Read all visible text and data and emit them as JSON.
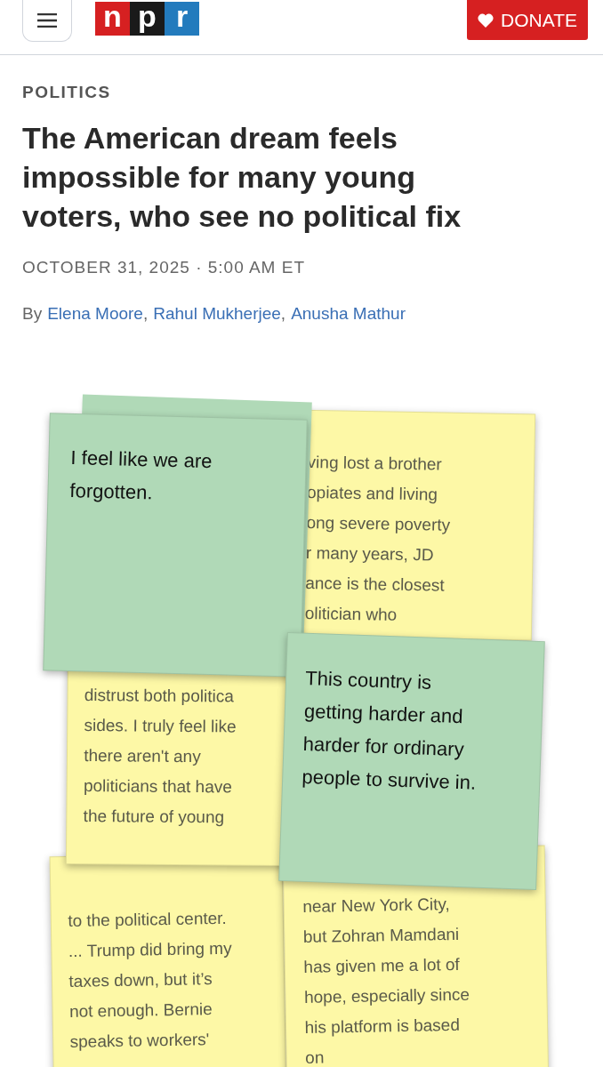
{
  "header": {
    "logo": [
      "n",
      "p",
      "r"
    ],
    "donate": "DONATE"
  },
  "section": "POLITICS",
  "headline": "The American dream feels impossible for many young voters, who see no political fix",
  "dateline": "OCTOBER 31, 2025 · 5:00 AM ET",
  "byline": {
    "prefix": "By",
    "separator": ",",
    "authors": [
      "Elena Moore",
      "Rahul Mukherjee",
      "Anusha Mathur"
    ]
  },
  "notes": [
    {
      "kind": "highlight",
      "color": "#b0d9b7",
      "lines": [
        "I feel like we are",
        "forgotten."
      ]
    },
    {
      "kind": "plain",
      "color": "#fdf8a6",
      "lines": [
        "distrust both politica",
        "sides. I truly feel like",
        "there aren't any",
        "politicians that have",
        "the future of young"
      ]
    },
    {
      "kind": "plain",
      "color": "#fdf8a6",
      "lines": [
        "to the political center.",
        "... Trump did bring my",
        "taxes down, but it’s",
        "not enough. Bernie",
        "speaks to workers'"
      ]
    },
    {
      "kind": "plain",
      "color": "#fdf8a6",
      "lines": [
        "ving lost a brother",
        "opiates and living",
        "ong severe poverty",
        "r many years, JD",
        "ance is the closest",
        "olitician who"
      ]
    },
    {
      "kind": "highlight",
      "color": "#b0d9b7",
      "lines": [
        "This country is",
        "getting harder and",
        "harder for ordinary",
        "people to survive in."
      ]
    },
    {
      "kind": "plain",
      "color": "#fdf8a6",
      "lines": [
        "near New York City,",
        "but Zohran Mamdani",
        "has given me a lot of",
        "hope, especially since",
        "his platform is based",
        "on"
      ]
    }
  ]
}
